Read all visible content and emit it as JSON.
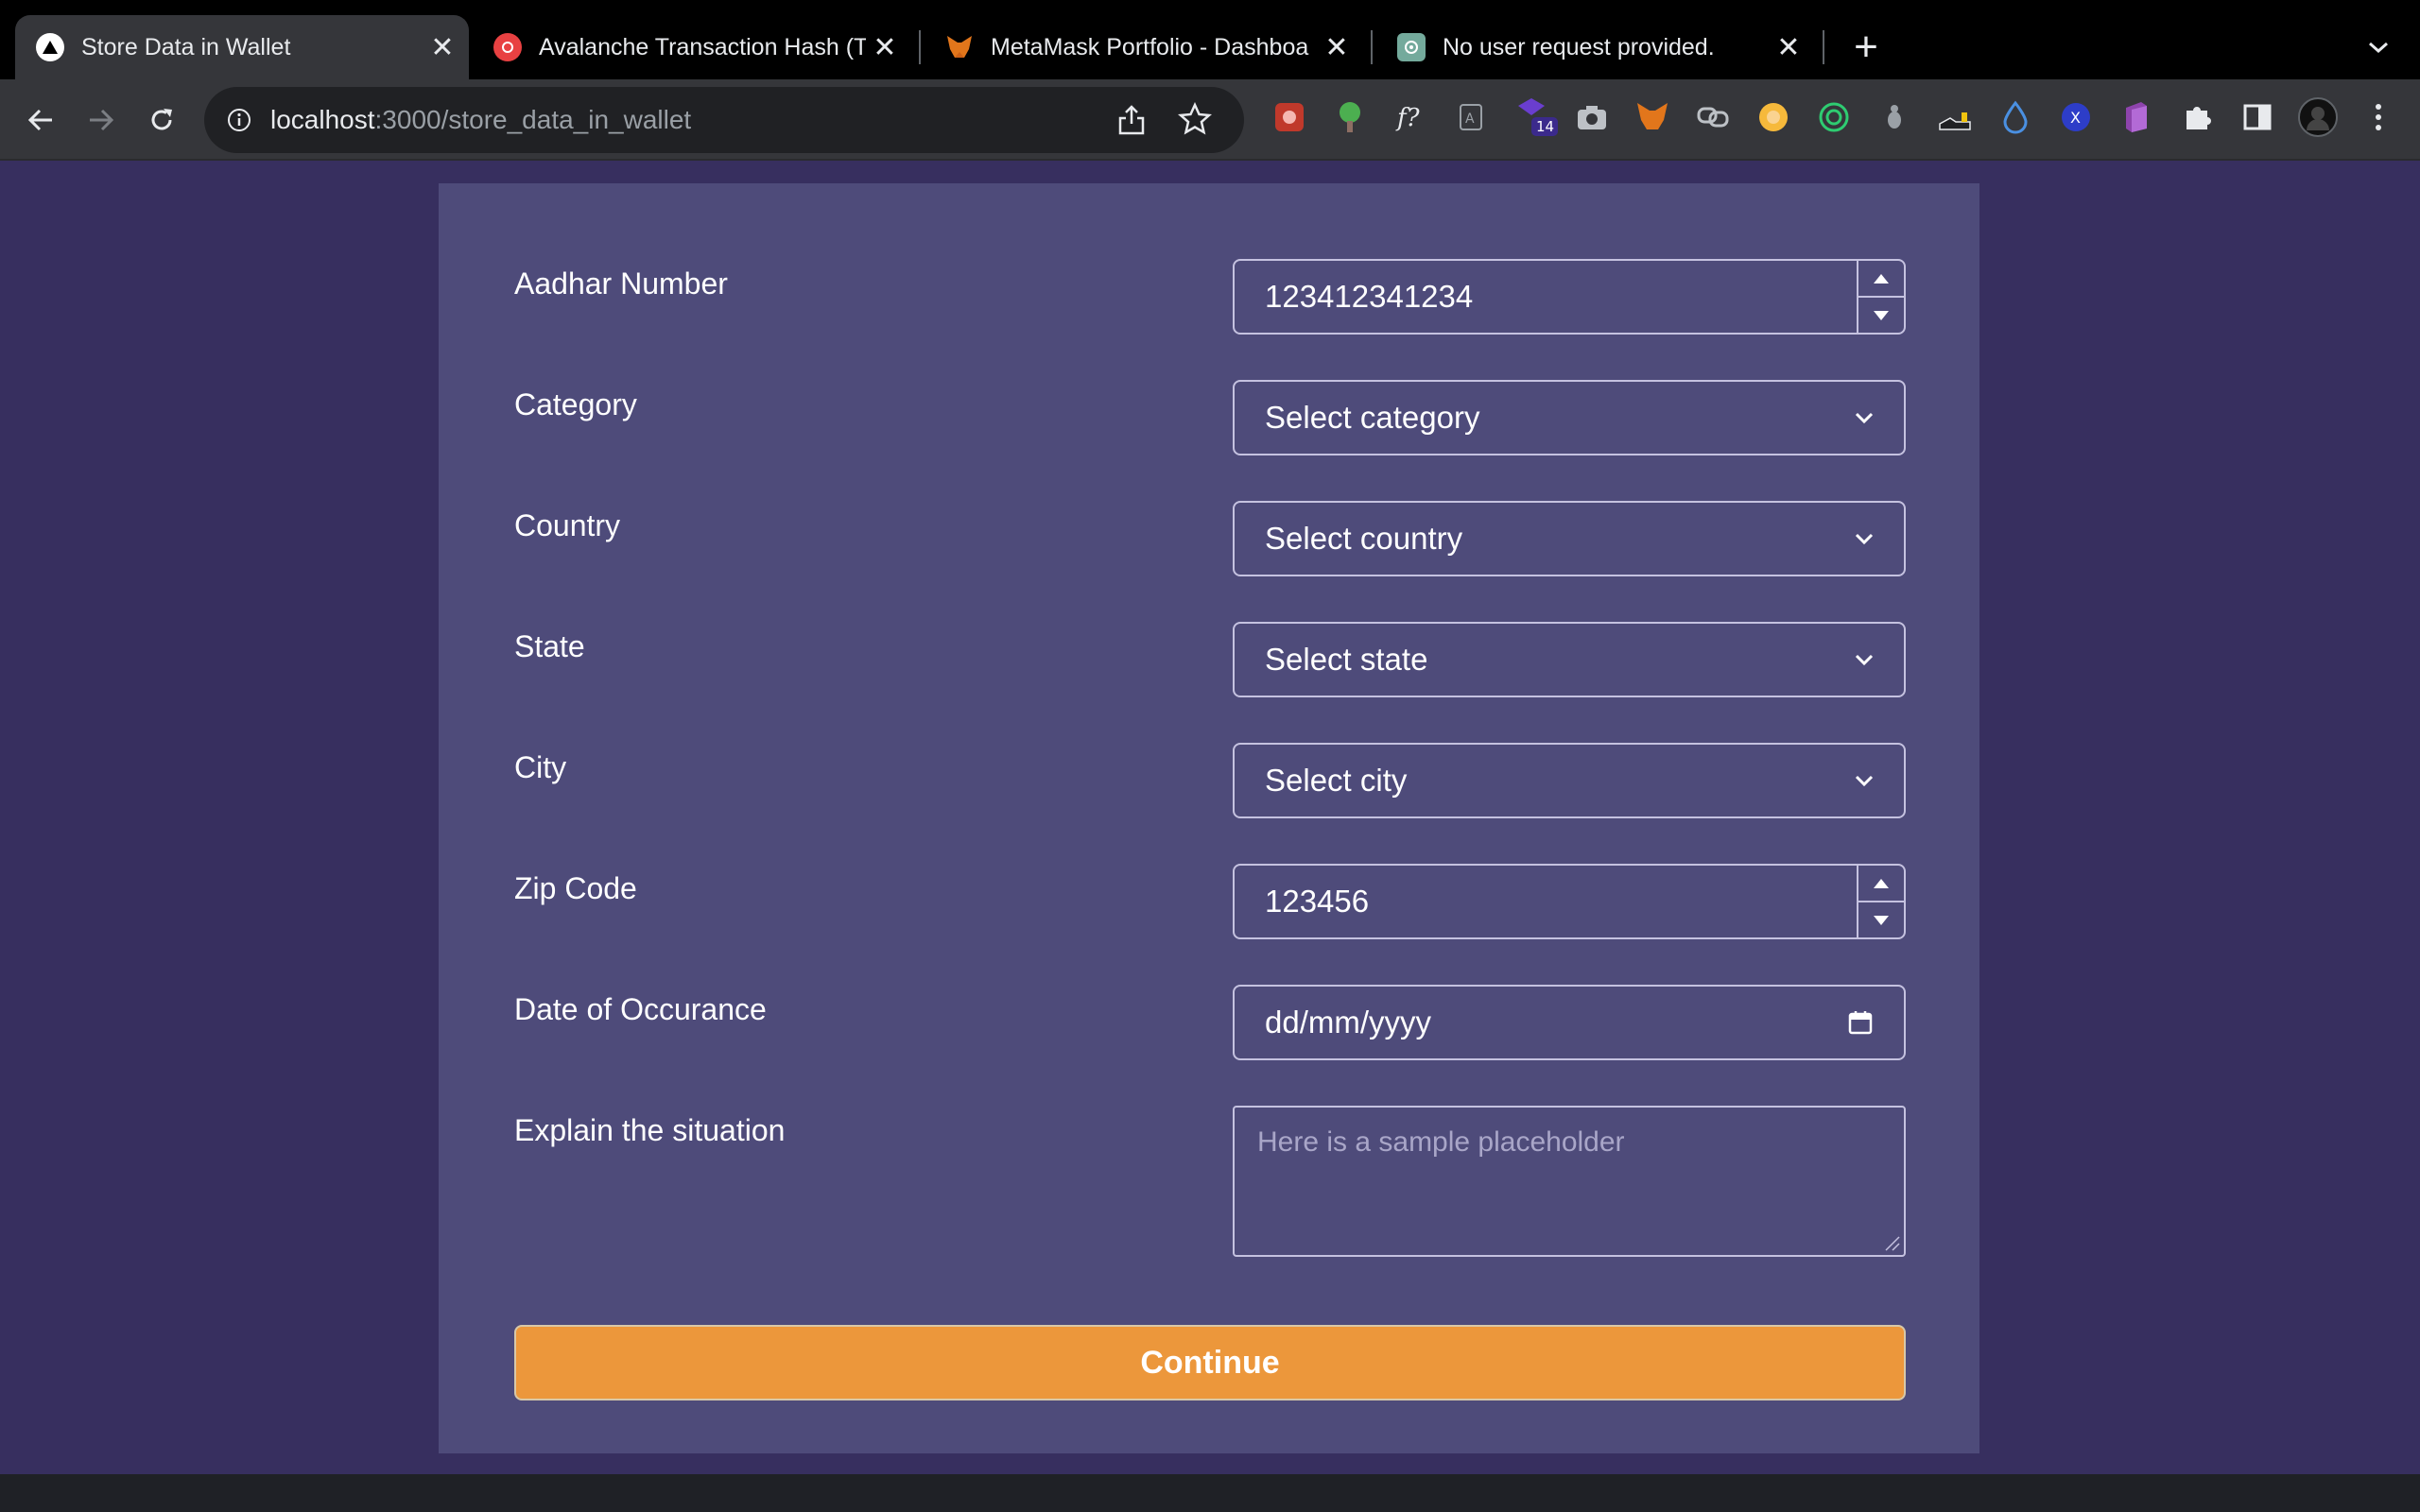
{
  "browser": {
    "tabs": [
      {
        "title": "Store Data in Wallet",
        "active": true,
        "icon": "triangle-logo-icon"
      },
      {
        "title": "Avalanche Transaction Hash (T",
        "active": false,
        "icon": "avalanche-icon"
      },
      {
        "title": "MetaMask Portfolio - Dashboa",
        "active": false,
        "icon": "metamask-fox-icon"
      },
      {
        "title": "No user request provided.",
        "active": false,
        "icon": "openai-icon"
      }
    ],
    "new_tab": "+",
    "url_host": "localhost",
    "url_path": ":3000/store_data_in_wallet",
    "extension_badge": "14"
  },
  "form": {
    "aadhar": {
      "label": "Aadhar Number",
      "value": "123412341234"
    },
    "category": {
      "label": "Category",
      "value": "Select category"
    },
    "country": {
      "label": "Country",
      "value": "Select country"
    },
    "state": {
      "label": "State",
      "value": "Select state"
    },
    "city": {
      "label": "City",
      "value": "Select city"
    },
    "zip": {
      "label": "Zip Code",
      "value": "123456"
    },
    "date": {
      "label": "Date of Occurance",
      "value": "dd/mm/yyyy"
    },
    "situation": {
      "label": "Explain the situation",
      "placeholder": "Here is a sample placeholder"
    },
    "continue_label": "Continue"
  },
  "colors": {
    "page_bg": "#372f5f",
    "card_bg": "#4e4b7a",
    "button_bg": "#ec973b"
  }
}
